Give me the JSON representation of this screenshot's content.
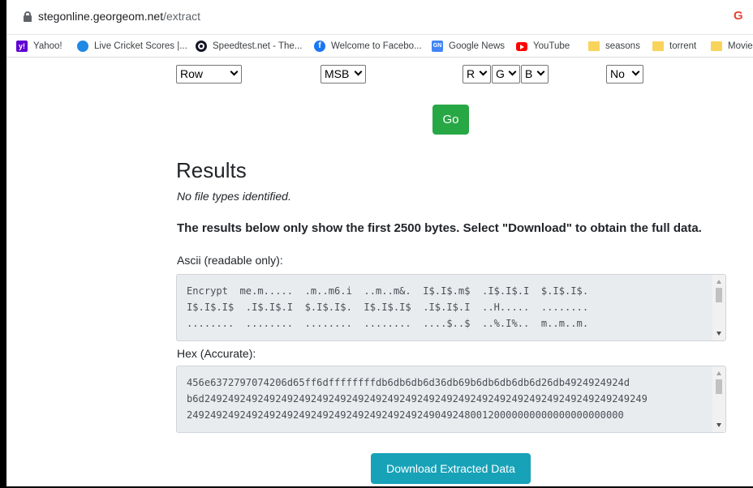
{
  "browser": {
    "url_host": "stegonline.georgeom.net",
    "url_path": "/extract"
  },
  "bookmarks": [
    {
      "label": "Yahoo!",
      "icon": "yahoo-icon"
    },
    {
      "label": "Live Cricket Scores |...",
      "icon": "cricket-icon"
    },
    {
      "label": "Speedtest.net - The...",
      "icon": "speedtest-icon"
    },
    {
      "label": "Welcome to Facebo...",
      "icon": "facebook-icon"
    },
    {
      "label": "Google News",
      "icon": "google-news-icon"
    },
    {
      "label": "YouTube",
      "icon": "youtube-icon"
    },
    {
      "label": "seasons",
      "icon": "folder-icon"
    },
    {
      "label": "torrent",
      "icon": "folder-icon"
    },
    {
      "label": "Movie",
      "icon": "folder-icon"
    }
  ],
  "options": {
    "order": "Row",
    "bit_order": "MSB",
    "channel_r": "R",
    "channel_g": "G",
    "channel_b": "B",
    "alpha": "No"
  },
  "go_label": "Go",
  "results": {
    "title": "Results",
    "no_file_types": "No file types identified.",
    "notice": "The results below only show the first 2500 bytes. Select \"Download\" to obtain the full data.",
    "ascii_label": "Ascii (readable only):",
    "ascii_lines": [
      "Encrypt  me.m.....  .m..m6.i  ..m..m&.  I$.I$.m$  .I$.I$.I  $.I$.I$.",
      "I$.I$.I$  .I$.I$.I  $.I$.I$.  I$.I$.I$  .I$.I$.I  ..H.....  ........",
      "........  ........  ........  ........  ....$..$  ..%.I%..  m..m..m."
    ],
    "hex_label": "Hex (Accurate):",
    "hex_lines": [
      "456e6372797074206d65ff6dffffffffdb6db6db6d36db69b6db6db6db6d26db4924924924d",
      "b6d249249249249249249249249249249249249249249249249249249249249249249249249249",
      "24924924924924924924924924924924924924924904924800120000000000000000000000"
    ],
    "download_label": "Download Extracted Data"
  },
  "colors": {
    "go_button": "#28a745",
    "download_button": "#17a2b8",
    "textarea_bg": "#e9ecef"
  }
}
